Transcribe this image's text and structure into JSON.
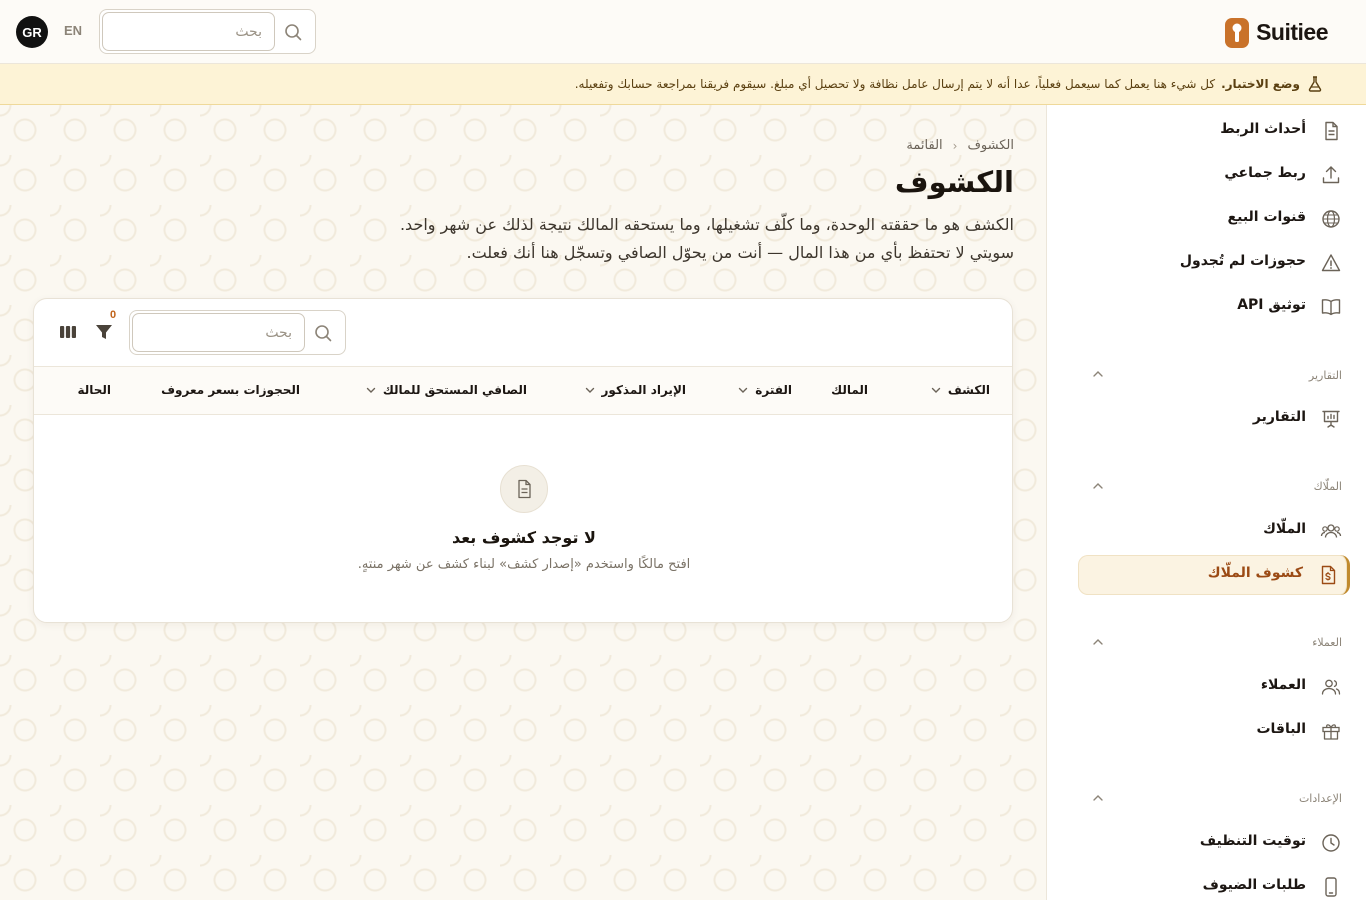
{
  "header": {
    "brand": "Suitiee",
    "avatar_initials": "GR",
    "language": "EN",
    "search_placeholder": "بحث"
  },
  "banner": {
    "title": "وضع الاختبار.",
    "message": "كل شيء هنا يعمل كما سيعمل فعلياً، عدا أنه لا يتم إرسال عامل نظافة ولا تحصيل أي مبلغ. سيقوم فريقنا بمراجعة حسابك وتفعيله."
  },
  "sidebar": {
    "items_top": [
      {
        "label": "أحداث الربط",
        "icon": "document-icon"
      },
      {
        "label": "ربط جماعي",
        "icon": "upload-icon"
      },
      {
        "label": "قنوات البيع",
        "icon": "globe-icon"
      },
      {
        "label": "حجوزات لم تُجدول",
        "icon": "warning-icon"
      },
      {
        "label": "توثيق API",
        "icon": "book-icon"
      }
    ],
    "sections": [
      {
        "title": "التقارير",
        "items": [
          {
            "label": "التقارير",
            "icon": "presentation-chart-icon"
          }
        ]
      },
      {
        "title": "الملّاك",
        "items": [
          {
            "label": "الملّاك",
            "icon": "users-group-icon"
          },
          {
            "label": "كشوف الملّاك",
            "icon": "money-document-icon",
            "active": true
          }
        ]
      },
      {
        "title": "العملاء",
        "items": [
          {
            "label": "العملاء",
            "icon": "users-icon"
          },
          {
            "label": "الباقات",
            "icon": "gift-icon"
          }
        ]
      },
      {
        "title": "الإعدادات",
        "items": [
          {
            "label": "توقيت التنظيف",
            "icon": "clock-icon"
          },
          {
            "label": "طلبات الضيوف",
            "icon": "mobile-icon"
          }
        ]
      }
    ]
  },
  "main": {
    "breadcrumb": [
      "الكشوف",
      "القائمة"
    ],
    "title": "الكشوف",
    "description_line1": "الكشف هو ما حققته الوحدة، وما كلّف تشغيلها، وما يستحقه المالك نتيجة لذلك عن شهر واحد.",
    "description_line2": "سويتي لا تحتفظ بأي من هذا المال — أنت من يحوّل الصافي وتسجّل هنا أنك فعلت."
  },
  "table": {
    "search_placeholder": "بحث",
    "filter_count": "0",
    "columns": [
      "الكشف",
      "المالك",
      "الفترة",
      "الإيراد المذكور",
      "الصافي المستحق للمالك",
      "الحجوزات بسعر معروف",
      "الحالة"
    ],
    "empty_title": "لا توجد كشوف بعد",
    "empty_subtitle": "افتح مالكًا واستخدم «إصدار كشف» لبناء كشف عن شهر منتهٍ."
  },
  "colors": {
    "accent": "#c08a2e",
    "active_text": "#9b4a14",
    "banner_bg": "#fdf3d6",
    "brand_mark": "#c9722a"
  }
}
